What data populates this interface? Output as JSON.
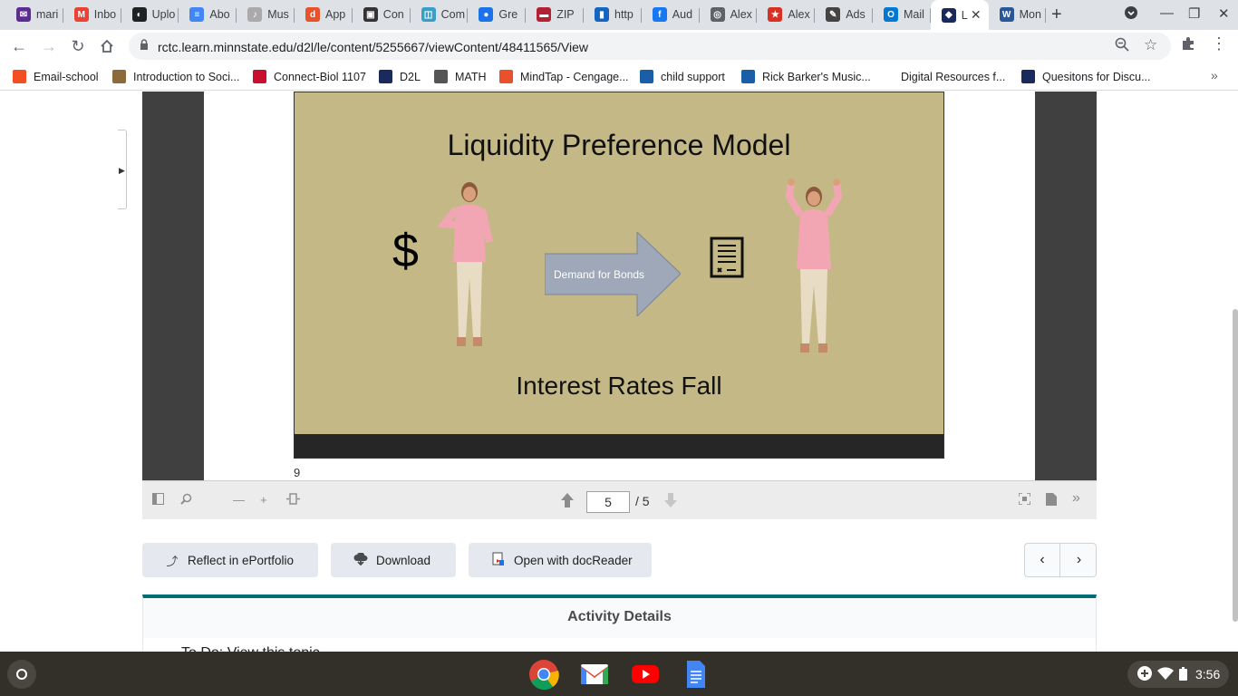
{
  "browser": {
    "tabs": [
      {
        "label": "mari",
        "icon": "mail-icon",
        "color": "#5c2d91"
      },
      {
        "label": "Inbo",
        "icon": "gmail-icon",
        "color": "#ea4335"
      },
      {
        "label": "Uplo",
        "icon": "upload-icon",
        "color": "#202124"
      },
      {
        "label": "Abo",
        "icon": "docs-icon",
        "color": "#4285f4"
      },
      {
        "label": "Mus",
        "icon": "music-icon",
        "color": "#aaaaaa"
      },
      {
        "label": "App",
        "icon": "app-icon",
        "color": "#e8512a"
      },
      {
        "label": "Con",
        "icon": "book-icon",
        "color": "#333333"
      },
      {
        "label": "Com",
        "icon": "box-icon",
        "color": "#37a0c8"
      },
      {
        "label": "Gre",
        "icon": "map-pin-icon",
        "color": "#1a73e8"
      },
      {
        "label": "ZIP",
        "icon": "flag-icon",
        "color": "#b22234"
      },
      {
        "label": "http",
        "icon": "bar-chart-icon",
        "color": "#1565c0"
      },
      {
        "label": "Aud",
        "icon": "facebook-icon",
        "color": "#1877f2"
      },
      {
        "label": "Alex",
        "icon": "globe-icon",
        "color": "#5f6368"
      },
      {
        "label": "Alex",
        "icon": "star-icon",
        "color": "#d93025"
      },
      {
        "label": "Ads",
        "icon": "edit-icon",
        "color": "#444444"
      },
      {
        "label": "Mail",
        "icon": "outlook-icon",
        "color": "#0078d4"
      },
      {
        "label": "L",
        "icon": "d2l-icon",
        "color": "#1b2a5c",
        "active": true
      },
      {
        "label": "Mon",
        "icon": "word-icon",
        "color": "#2b579a"
      }
    ],
    "url": "rctc.learn.minnstate.edu/d2l/le/content/5255667/viewContent/48411565/View",
    "bookmarks": [
      {
        "label": "Email-school",
        "color": "#f25022"
      },
      {
        "label": "Introduction to Soci...",
        "color": "#8b6b3a"
      },
      {
        "label": "Connect-Biol 1107",
        "color": "#c8102e"
      },
      {
        "label": "D2L",
        "color": "#1b2a5c"
      },
      {
        "label": "MATH",
        "color": "#555555"
      },
      {
        "label": "MindTap - Cengage...",
        "color": "#e8512a"
      },
      {
        "label": "child support",
        "color": "#1a5ea8"
      },
      {
        "label": "Rick Barker's Music...",
        "color": "#1a5ea8"
      },
      {
        "label": "Digital Resources f...",
        "color": "#ffffff"
      },
      {
        "label": "Quesitons for Discu...",
        "color": "#1b2a5c"
      }
    ]
  },
  "viewer": {
    "slide": {
      "title": "Liquidity Preference Model",
      "dollar": "$",
      "arrow_label": "Demand for Bonds",
      "bottom_text": "Interest Rates Fall"
    },
    "page_footer": "9",
    "current_page": "5",
    "total_pages": "/ 5"
  },
  "actions": {
    "reflect": "Reflect in ePortfolio",
    "download": "Download",
    "docreader": "Open with docReader"
  },
  "activity": {
    "title": "Activity Details",
    "item": "To Do: View this topic"
  },
  "shelf": {
    "time": "3:56",
    "apps": [
      "chrome-icon",
      "gmail-icon",
      "youtube-icon",
      "docs-icon"
    ]
  }
}
